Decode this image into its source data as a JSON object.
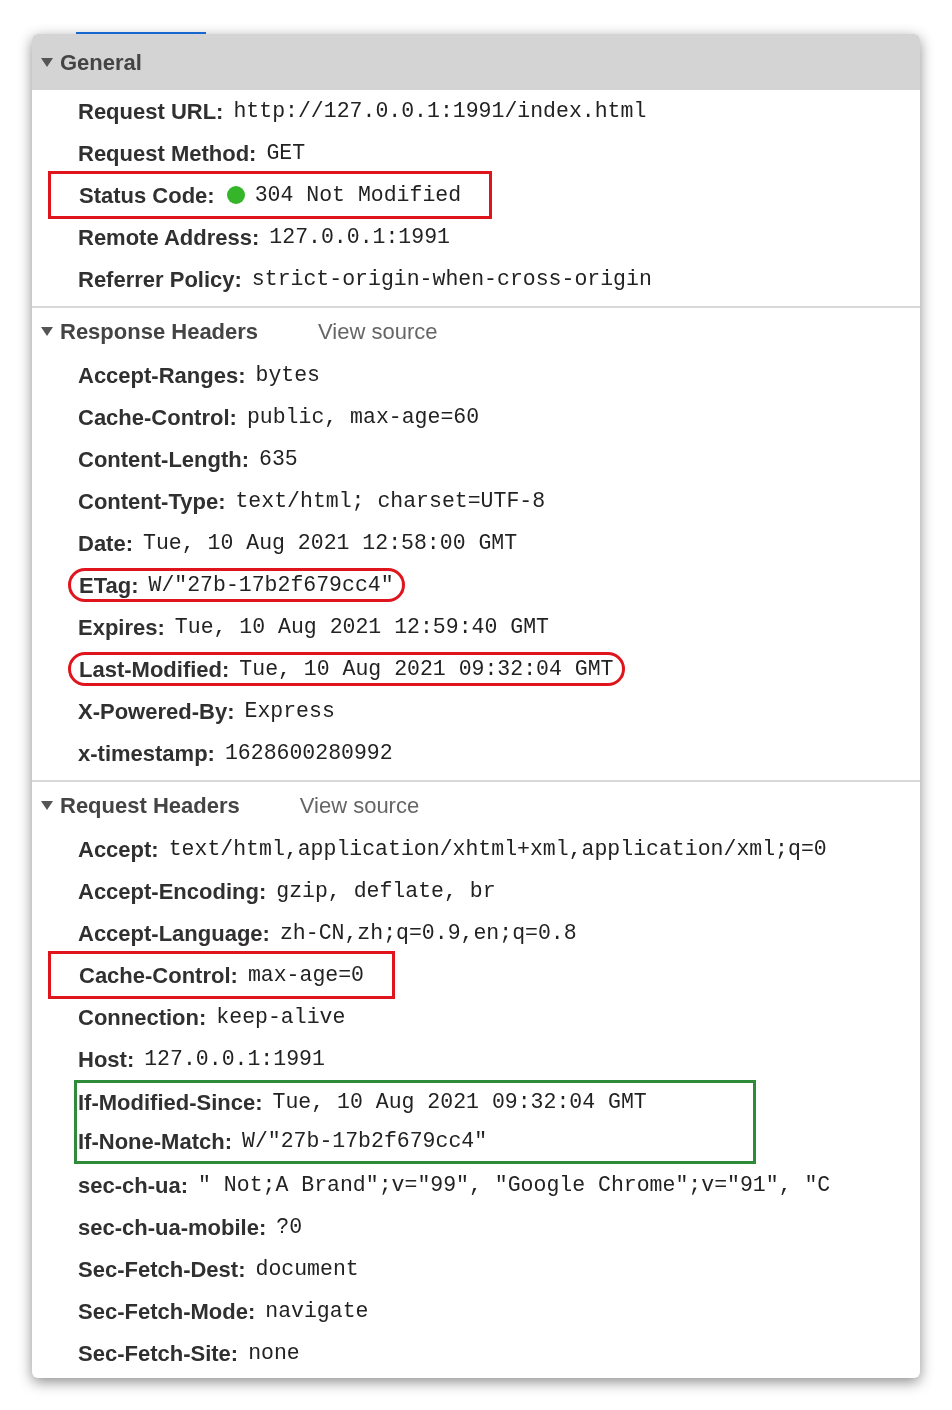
{
  "sections": [
    {
      "title": "General",
      "expanded": true,
      "focused": true,
      "rows": [
        {
          "kind": "row",
          "name": "Request URL:",
          "value": "http://127.0.0.1:1991/index.html"
        },
        {
          "kind": "row",
          "name": "Request Method:",
          "value": "GET"
        },
        {
          "kind": "row",
          "name": "Status Code:",
          "value": "304 Not Modified",
          "color": "#34b52a",
          "mark": {
            "kind": "box",
            "color": "#e0141c"
          }
        },
        {
          "kind": "row",
          "name": "Remote Address:",
          "value": "127.0.0.1:1991"
        },
        {
          "kind": "row",
          "name": "Referrer Policy:",
          "value": "strict-origin-when-cross-origin"
        }
      ]
    },
    {
      "title": "Response Headers",
      "link": "View source",
      "expanded": true,
      "focused": false,
      "rows": [
        {
          "kind": "row",
          "name": "Accept-Ranges:",
          "value": "bytes"
        },
        {
          "kind": "row",
          "name": "Cache-Control:",
          "value": "public, max-age=60"
        },
        {
          "kind": "row",
          "name": "Content-Length:",
          "value": "635"
        },
        {
          "kind": "row",
          "name": "Content-Type:",
          "value": "text/html; charset=UTF-8"
        },
        {
          "kind": "row",
          "name": "Date:",
          "value": "Tue, 10 Aug 2021 12:58:00 GMT"
        },
        {
          "kind": "row",
          "name": "ETag:",
          "value": "W/\"27b-17b2f679cc4\"",
          "mark": {
            "kind": "oval",
            "color": "#e0141c"
          }
        },
        {
          "kind": "row",
          "name": "Expires:",
          "value": "Tue, 10 Aug 2021 12:59:40 GMT"
        },
        {
          "kind": "row",
          "name": "Last-Modified:",
          "value": "Tue, 10 Aug 2021 09:32:04 GMT",
          "mark": {
            "kind": "oval",
            "color": "#e0141c"
          }
        },
        {
          "kind": "row",
          "name": "X-Powered-By:",
          "value": "Express"
        },
        {
          "kind": "row",
          "name": "x-timestamp:",
          "value": "1628600280992"
        }
      ]
    },
    {
      "title": "Request Headers",
      "link": "View source",
      "expanded": true,
      "focused": false,
      "rows": [
        {
          "kind": "row",
          "name": "Accept:",
          "value": "text/html,application/xhtml+xml,application/xml;q=0"
        },
        {
          "kind": "row",
          "name": "Accept-Encoding:",
          "value": "gzip, deflate, br"
        },
        {
          "kind": "row",
          "name": "Accept-Language:",
          "value": "zh-CN,zh;q=0.9,en;q=0.8"
        },
        {
          "kind": "row",
          "name": "Cache-Control:",
          "value": "max-age=0",
          "mark": {
            "kind": "box",
            "color": "#e0141c"
          }
        },
        {
          "kind": "row",
          "name": "Connection:",
          "value": "keep-alive"
        },
        {
          "kind": "row",
          "name": "Host:",
          "value": "127.0.0.1:1991"
        },
        {
          "kind": "group",
          "mark": {
            "kind": "box",
            "color": "#2e8b3a"
          },
          "rows": [
            {
              "kind": "row",
              "name": "If-Modified-Since:",
              "value": "Tue, 10 Aug 2021 09:32:04 GMT"
            },
            {
              "kind": "row",
              "name": "If-None-Match:",
              "value": "W/\"27b-17b2f679cc4\""
            }
          ]
        },
        {
          "kind": "row",
          "name": "sec-ch-ua:",
          "value": "\" Not;A Brand\";v=\"99\", \"Google Chrome\";v=\"91\", \"C"
        },
        {
          "kind": "row",
          "name": "sec-ch-ua-mobile:",
          "value": "?0"
        },
        {
          "kind": "row",
          "name": "Sec-Fetch-Dest:",
          "value": "document"
        },
        {
          "kind": "row",
          "name": "Sec-Fetch-Mode:",
          "value": "navigate"
        },
        {
          "kind": "row",
          "name": "Sec-Fetch-Site:",
          "value": "none"
        }
      ]
    }
  ]
}
